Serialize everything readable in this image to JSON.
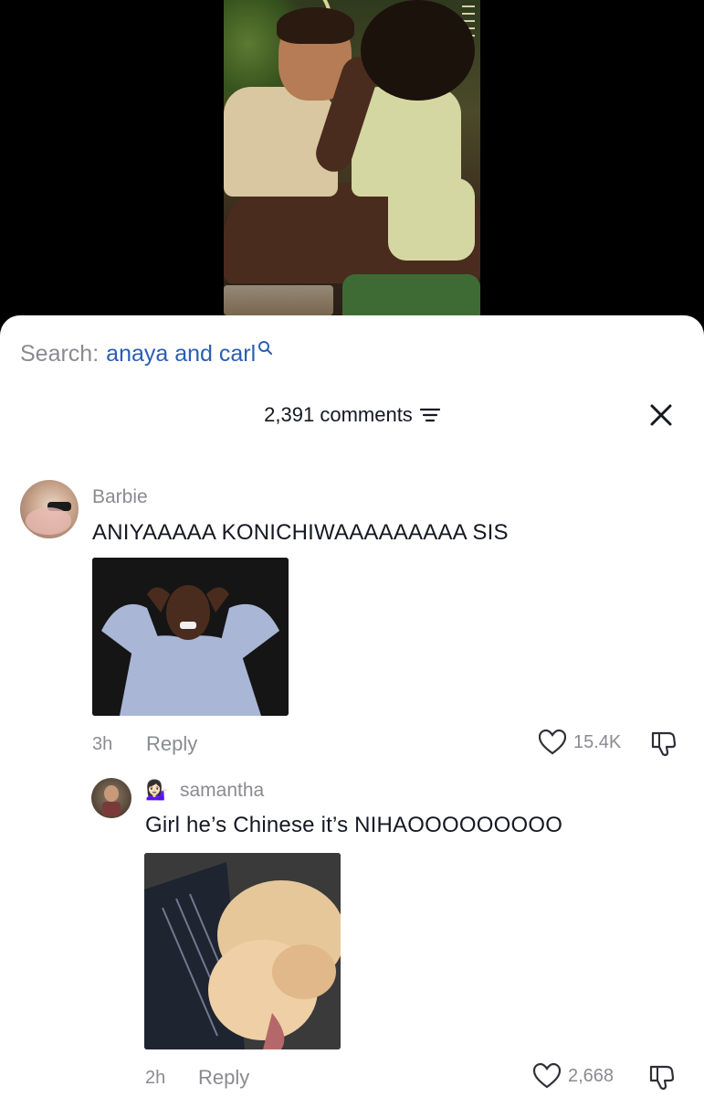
{
  "search": {
    "prefix": "Search:",
    "query": "anaya and carl"
  },
  "header": {
    "comments_count": "2,391 comments"
  },
  "comments": [
    {
      "username": "Barbie",
      "text": "ANIYAAAAA KONICHIWAAAAAAAAA SIS",
      "time": "3h",
      "reply_label": "Reply",
      "likes": "15.4K"
    },
    {
      "username": "samantha",
      "username_emoji": "💁🏻‍♀️",
      "text": "Girl he’s Chinese it’s NIHAOOOOOOOOO",
      "time": "2h",
      "reply_label": "Reply",
      "likes": "2,668"
    }
  ],
  "icons": {
    "search": "search-icon",
    "sort": "sort-icon",
    "close": "close-icon",
    "like": "heart-icon",
    "dislike": "dislike-icon"
  },
  "colors": {
    "link_blue": "#2b5db2",
    "muted_gray": "#8a8b91",
    "text_dark": "#161823"
  }
}
